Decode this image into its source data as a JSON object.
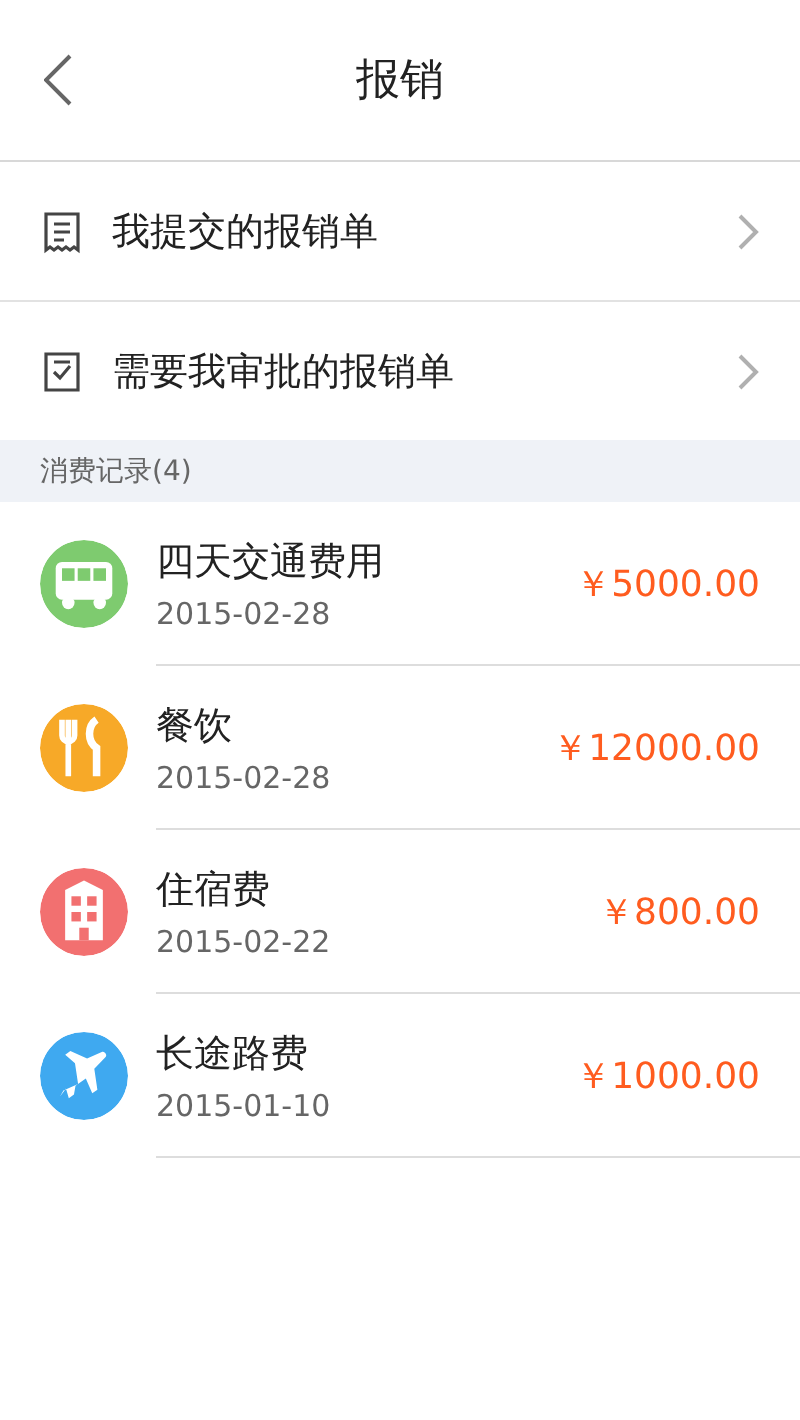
{
  "header": {
    "title": "报销"
  },
  "menu": [
    {
      "kind": "submitted",
      "label": "我提交的报销单"
    },
    {
      "kind": "approve",
      "label": "需要我审批的报销单"
    }
  ],
  "section": {
    "title": "消费记录(4)"
  },
  "records": [
    {
      "kind": "bus",
      "color": "#7ecb6f",
      "name": "四天交通费用",
      "date": "2015-02-28",
      "amount": "￥5000.00"
    },
    {
      "kind": "food",
      "color": "#f7a928",
      "name": "餐饮",
      "date": "2015-02-28",
      "amount": "￥12000.00"
    },
    {
      "kind": "hotel",
      "color": "#f27070",
      "name": "住宿费",
      "date": "2015-02-22",
      "amount": "￥800.00"
    },
    {
      "kind": "plane",
      "color": "#3fa9f0",
      "name": "长途路费",
      "date": "2015-01-10",
      "amount": "￥1000.00"
    }
  ]
}
